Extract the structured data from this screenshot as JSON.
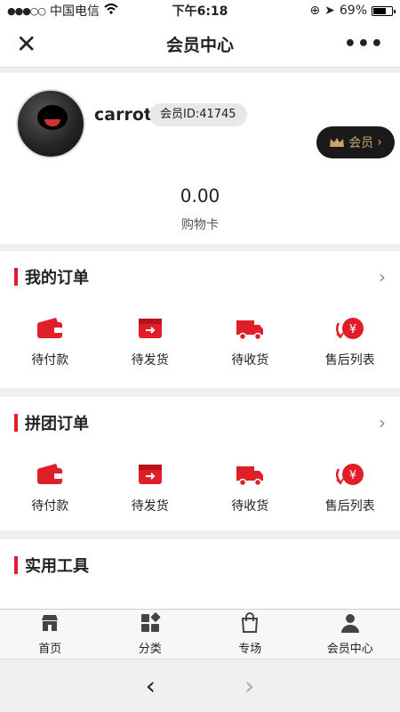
{
  "status": {
    "carrier": "中国电信",
    "time": "下午6:18",
    "battery_text": "69%",
    "battery_level": 0.69
  },
  "nav": {
    "title": "会员中心",
    "close_icon": "close-icon",
    "more_icon": "more-icon"
  },
  "profile": {
    "username": "carrot",
    "member_id": "会员ID:41745",
    "member_button": "会员",
    "balance": "0.00",
    "balance_label": "购物卡"
  },
  "orders": {
    "title": "我的订单",
    "items": [
      {
        "label": "待付款",
        "icon": "wallet-icon"
      },
      {
        "label": "待发货",
        "icon": "box-icon"
      },
      {
        "label": "待收货",
        "icon": "truck-icon"
      },
      {
        "label": "售后列表",
        "icon": "yen-refund-icon"
      }
    ]
  },
  "group_orders": {
    "title": "拼团订单",
    "items": [
      {
        "label": "待付款",
        "icon": "wallet-icon"
      },
      {
        "label": "待发货",
        "icon": "box-icon"
      },
      {
        "label": "待收货",
        "icon": "truck-icon"
      },
      {
        "label": "售后列表",
        "icon": "yen-refund-icon"
      }
    ]
  },
  "tools": {
    "title": "实用工具"
  },
  "tabbar": [
    {
      "label": "首页",
      "icon": "shop-icon"
    },
    {
      "label": "分类",
      "icon": "grid-icon"
    },
    {
      "label": "专场",
      "icon": "bag-icon"
    },
    {
      "label": "会员中心",
      "icon": "user-icon"
    }
  ],
  "colors": {
    "accent": "#e01e28",
    "gold": "#c9a46a",
    "dark": "#1a1a1a"
  }
}
